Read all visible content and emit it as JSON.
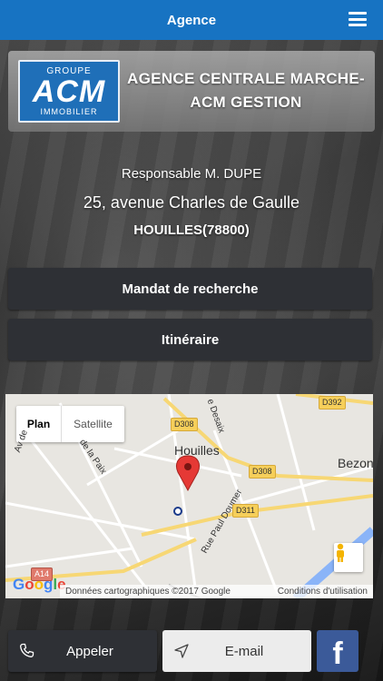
{
  "header": {
    "title": "Agence"
  },
  "agency": {
    "logo": {
      "line1": "GROUPE",
      "line2": "ACM",
      "line3": "IMMOBILIER"
    },
    "name": "AGENCE CENTRALE MARCHE-ACM GESTION",
    "responsible": "Responsable M. DUPE",
    "address": "25, avenue Charles de Gaulle",
    "city": "HOUILLES(78800)"
  },
  "actions": {
    "mandat_label": "Mandat de recherche",
    "itineraire_label": "Itinéraire"
  },
  "map": {
    "toggle": {
      "plan": "Plan",
      "satellite": "Satellite"
    },
    "labels": {
      "city": "Houilles",
      "city2": "Bezons",
      "street1": "Rue Paul Doumer",
      "street2": "de la Paix",
      "street3": "Av de",
      "street4": "e Desaix"
    },
    "roads": [
      "D392",
      "D308",
      "D308",
      "D311",
      "A14"
    ],
    "google": [
      "G",
      "o",
      "o",
      "g",
      "l",
      "e"
    ],
    "attribution": "Données cartographiques ©2017 Google",
    "terms": "Conditions d'utilisation"
  },
  "bottom": {
    "call_label": "Appeler",
    "email_label": "E-mail",
    "facebook_letter": "f"
  },
  "colors": {
    "header_bg": "#1773c2",
    "button_bg": "#2e3035",
    "facebook": "#3b5a99",
    "map_pin": "#e53935"
  }
}
